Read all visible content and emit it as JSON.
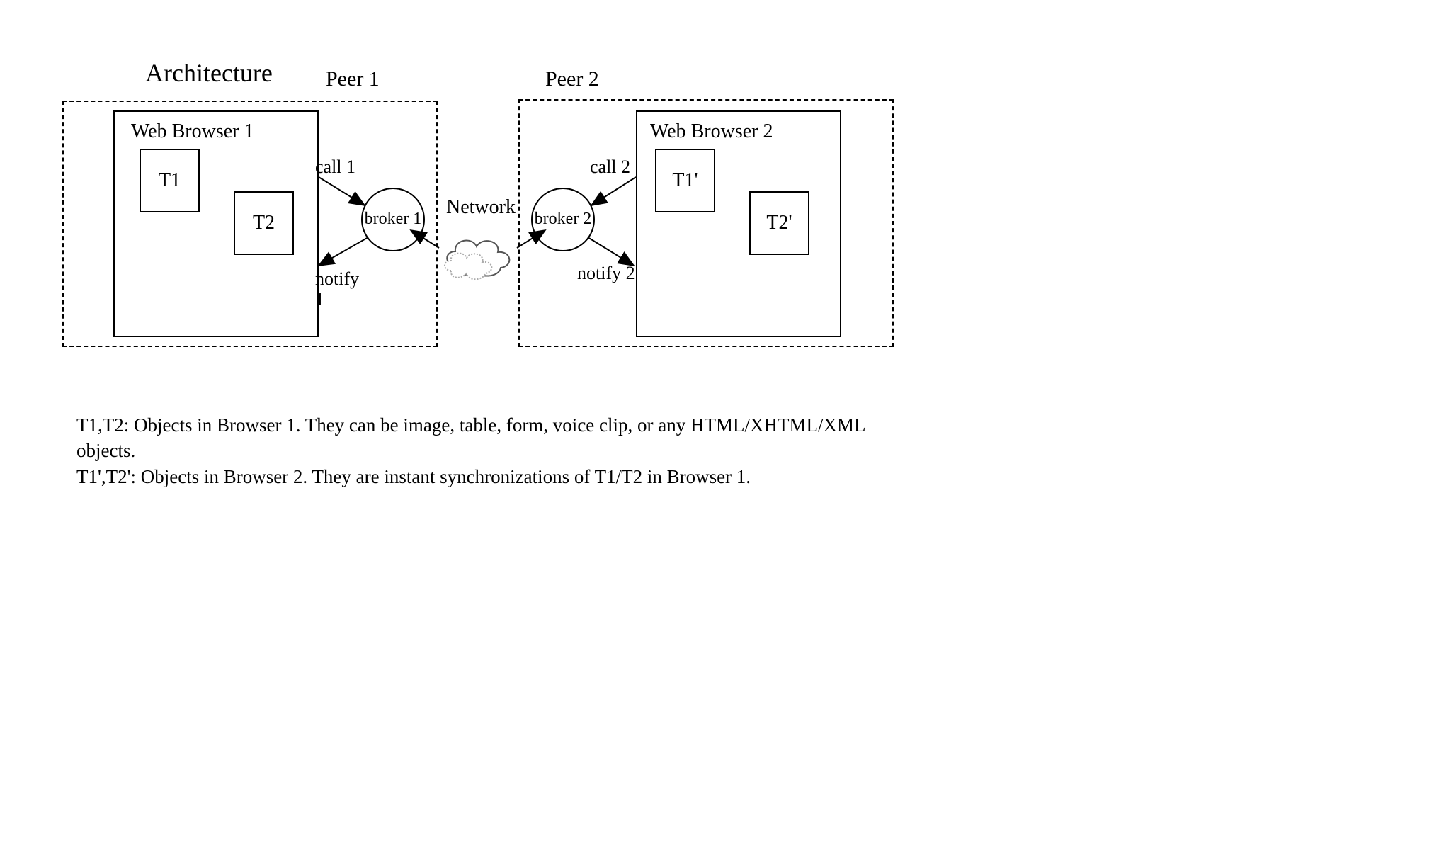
{
  "title": "Architecture",
  "peer1": {
    "label": "Peer 1",
    "browser_label": "Web Browser 1",
    "t1": "T1",
    "t2": "T2",
    "call": "call 1",
    "notify": "notify 1",
    "broker": "broker 1"
  },
  "peer2": {
    "label": "Peer 2",
    "browser_label": "Web Browser 2",
    "t1": "T1'",
    "t2": "T2'",
    "call": "call 2",
    "notify": "notify 2",
    "broker": "broker 2"
  },
  "network_label": "Network",
  "caption_line1": "T1,T2: Objects in Browser 1. They can be image, table, form, voice clip, or any HTML/XHTML/XML objects.",
  "caption_line2": "T1',T2': Objects in Browser 2. They are instant synchronizations of T1/T2 in Browser 1."
}
